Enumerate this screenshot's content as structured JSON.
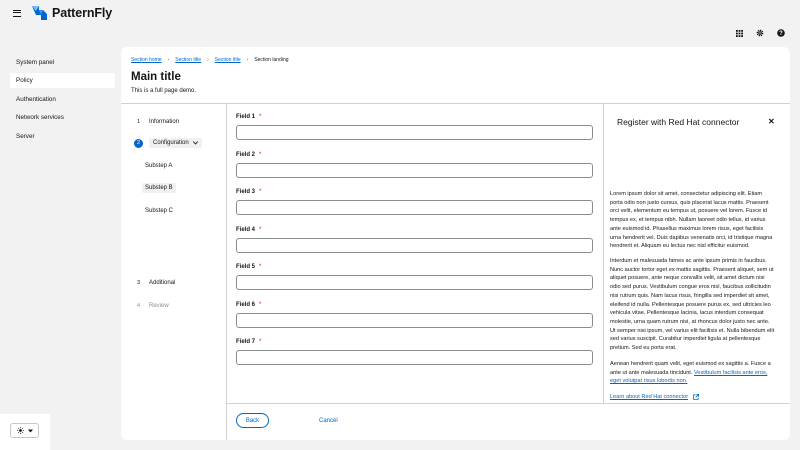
{
  "brand": {
    "name": "PatternFly"
  },
  "topbar": {
    "icons": [
      "grid-icon",
      "gear-icon",
      "help-icon"
    ]
  },
  "sidebar": {
    "items": [
      {
        "label": "System panel",
        "active": false
      },
      {
        "label": "Policy",
        "active": true
      },
      {
        "label": "Authentication",
        "active": false
      },
      {
        "label": "Network services",
        "active": false
      },
      {
        "label": "Server",
        "active": false
      }
    ]
  },
  "breadcrumb": {
    "items": [
      "Section home",
      "Section title",
      "Section title"
    ],
    "current": "Section landing"
  },
  "page": {
    "title": "Main title",
    "description": "This is a full page demo."
  },
  "wizard": {
    "steps": [
      {
        "num": "1",
        "label": "Information"
      },
      {
        "num": "2",
        "label": "Configuration"
      },
      {
        "num": "3",
        "label": "Additional"
      },
      {
        "num": "4",
        "label": "Review"
      }
    ],
    "substeps": [
      "Substep A",
      "Substep B",
      "Substep C"
    ],
    "current_substep": "Substep B"
  },
  "form": {
    "required_mark": "*",
    "fields": [
      {
        "label": "Field 1",
        "value": ""
      },
      {
        "label": "Field 2",
        "value": ""
      },
      {
        "label": "Field 3",
        "value": ""
      },
      {
        "label": "Field 4",
        "value": ""
      },
      {
        "label": "Field 5",
        "value": ""
      },
      {
        "label": "Field 6",
        "value": ""
      },
      {
        "label": "Field 7",
        "value": ""
      }
    ]
  },
  "footer": {
    "back_label": "Back",
    "cancel_label": "Cancel"
  },
  "drawer": {
    "title": "Register with Red Hat connector",
    "close": "✕",
    "paragraph1": "Lorem ipsum dolor sit amet, consectetur adipiscing elit. Etiam porta odio non justo cursus, quis placerat lacus mattis. Praesent orci velit, elementum eu tempus ut, posuere vel lorem. Fusce id tempus ex, et tempus nibh. Nullam laoreet odio tellus, id varius ante euismod id. Phasellus maximus lorem risus, eget facilisis urna hendrerit vel. Duis dapibus venenatis orci, id tristique magna hendrerit et. Aliquam eu lectus nec nisl efficitur euismod.",
    "paragraph2": "Interdum et malesuada fames ac ante ipsum primis in faucibus. Nunc auctor tortor eget ex mattis sagittis. Praesent aliquet, sem ut aliquet posuere, ante neque convallis velit, sit amet dictum nisi odio sed purus. Vestibulum congue eros nisl, faucibus sollicitudin nisi rutrum quis. Nam lacus risus, fringilla sed imperdiet sit amet, eleifend id nulla. Pellentesque posuere purus ex, sed ultricies leo vehicula vitae. Pellentesque lacinia, lacus interdum consequat molestie, urna quam rutrum nisi, at rhoncus dolor justo nec ante. Ut semper nisi ipsum, vel varius elit facilisis et. Nulla bibendum elit sed varius suscipit. Curabitur imperdiet ligula at pellentesque pretium. Sed eu porta erat.",
    "paragraph3_text": "Aenean hendrerit quam velit, eget euismod ex sagittis a. Fusce a ante ut ante malesuada tincidunt. ",
    "paragraph3_link": "Vestibulum facilisis ante eros, eget volutpat risus lobortis non.",
    "learn_more": "Learn about Red Hat connector"
  },
  "colors": {
    "accent": "#0066cc",
    "required": "#c9190b",
    "background": "#f2f2f2"
  }
}
